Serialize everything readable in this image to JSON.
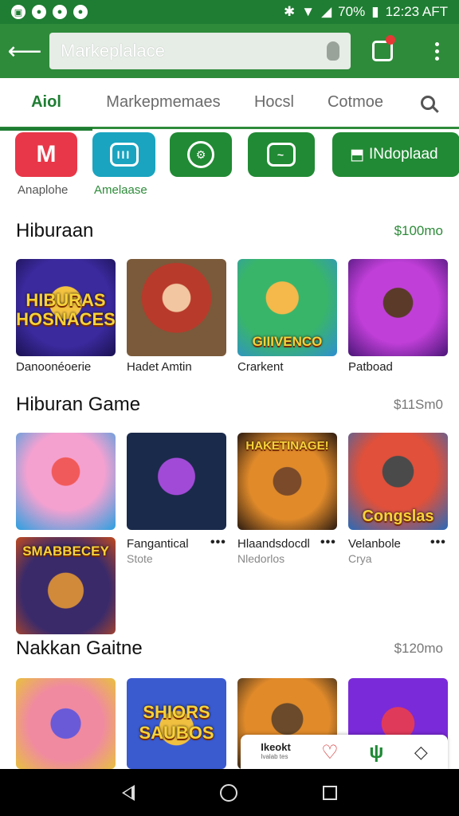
{
  "status_bar": {
    "time": "12:23 AFT",
    "battery": "70%",
    "left_icons": [
      "notification-icon",
      "app-icon",
      "app-icon",
      "app-icon"
    ]
  },
  "app_bar": {
    "search_placeholder": "Markeplalace"
  },
  "tabs": [
    {
      "label": "Aiol",
      "active": true
    },
    {
      "label": "Markepmemaes",
      "active": false
    },
    {
      "label": "Hocsl",
      "active": false
    },
    {
      "label": "Cotmoe",
      "active": false
    }
  ],
  "shortcuts": [
    {
      "label": "Anaplohe",
      "icon_text": "M"
    },
    {
      "label": "Amelaase",
      "icon_text": "III"
    },
    {
      "label": "",
      "icon_text": "⚙"
    },
    {
      "label": "",
      "icon_text": "~"
    },
    {
      "label": "INdoplaad"
    }
  ],
  "sections": [
    {
      "title": "Hiburaan",
      "meta": "$100mo",
      "items": [
        {
          "caption": "Danoonéoerie",
          "art": "HIBURAS\nHOSNACES"
        },
        {
          "caption": "Hadet Amtin",
          "art": ""
        },
        {
          "caption": "Crarkent",
          "art": "GIIIVENCO"
        },
        {
          "caption": "Patboad",
          "art": ""
        }
      ]
    },
    {
      "title": "Hiburan  Game",
      "meta": "$11Sm0",
      "items": [
        {
          "caption": "",
          "art": "",
          "sub": ""
        },
        {
          "caption": "Fangantical",
          "art": "",
          "sub": "Stote"
        },
        {
          "caption": "Hlaandsdocdl",
          "art": "HAKETINAGE!",
          "sub": "Nledorlos"
        },
        {
          "caption": "Velanbole",
          "art": "Congslas",
          "sub": "Crya"
        },
        {
          "art": "SMABBECEY"
        }
      ]
    },
    {
      "title": "Nakkan Gaitne",
      "meta": "$120mo",
      "items": [
        {
          "art": ""
        },
        {
          "art": "SHIORS\nSAUBOS"
        },
        {
          "art": ""
        },
        {
          "art": ""
        }
      ]
    }
  ],
  "bottom_pill": {
    "label": "Ikeokt",
    "sublabel": "Ivalab tes"
  }
}
